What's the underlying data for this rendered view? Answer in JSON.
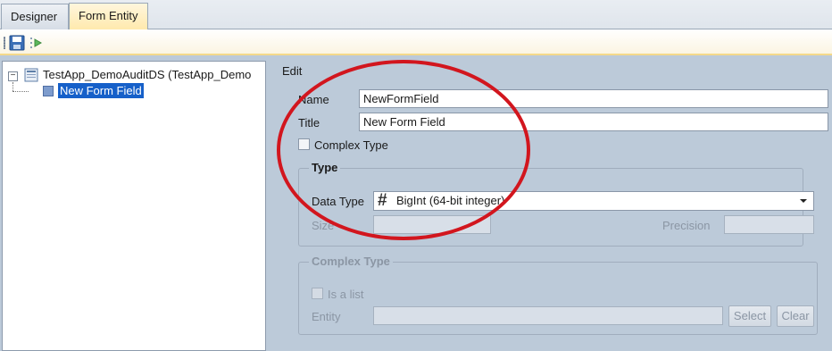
{
  "tabs": [
    {
      "label": "Designer",
      "active": false
    },
    {
      "label": "Form Entity",
      "active": true
    }
  ],
  "toolbar": {
    "icons": [
      "save-icon",
      "run-step-icon"
    ]
  },
  "tree": {
    "root_label": "TestApp_DemoAuditDS (TestApp_Demo",
    "expander": "−",
    "child_label": "New Form Field"
  },
  "edit": {
    "title": "Edit",
    "name_label": "Name",
    "name_value": "NewFormField",
    "title_label": "Title",
    "title_value": "New Form Field",
    "complex_type_checkbox_label": "Complex Type",
    "type_group": {
      "legend": "Type",
      "data_type_label": "Data Type",
      "data_type_value": "BigInt (64-bit integer)",
      "data_type_icon": "#",
      "size_label": "Size",
      "precision_label": "Precision"
    },
    "complex_group": {
      "legend": "Complex Type",
      "is_list_label": "Is a list",
      "entity_label": "Entity",
      "select_button": "Select",
      "clear_button": "Clear"
    }
  },
  "colors": {
    "annotation_circle": "#d2161e",
    "selection": "#1660c9",
    "active_tab": "#ffe9ac"
  }
}
